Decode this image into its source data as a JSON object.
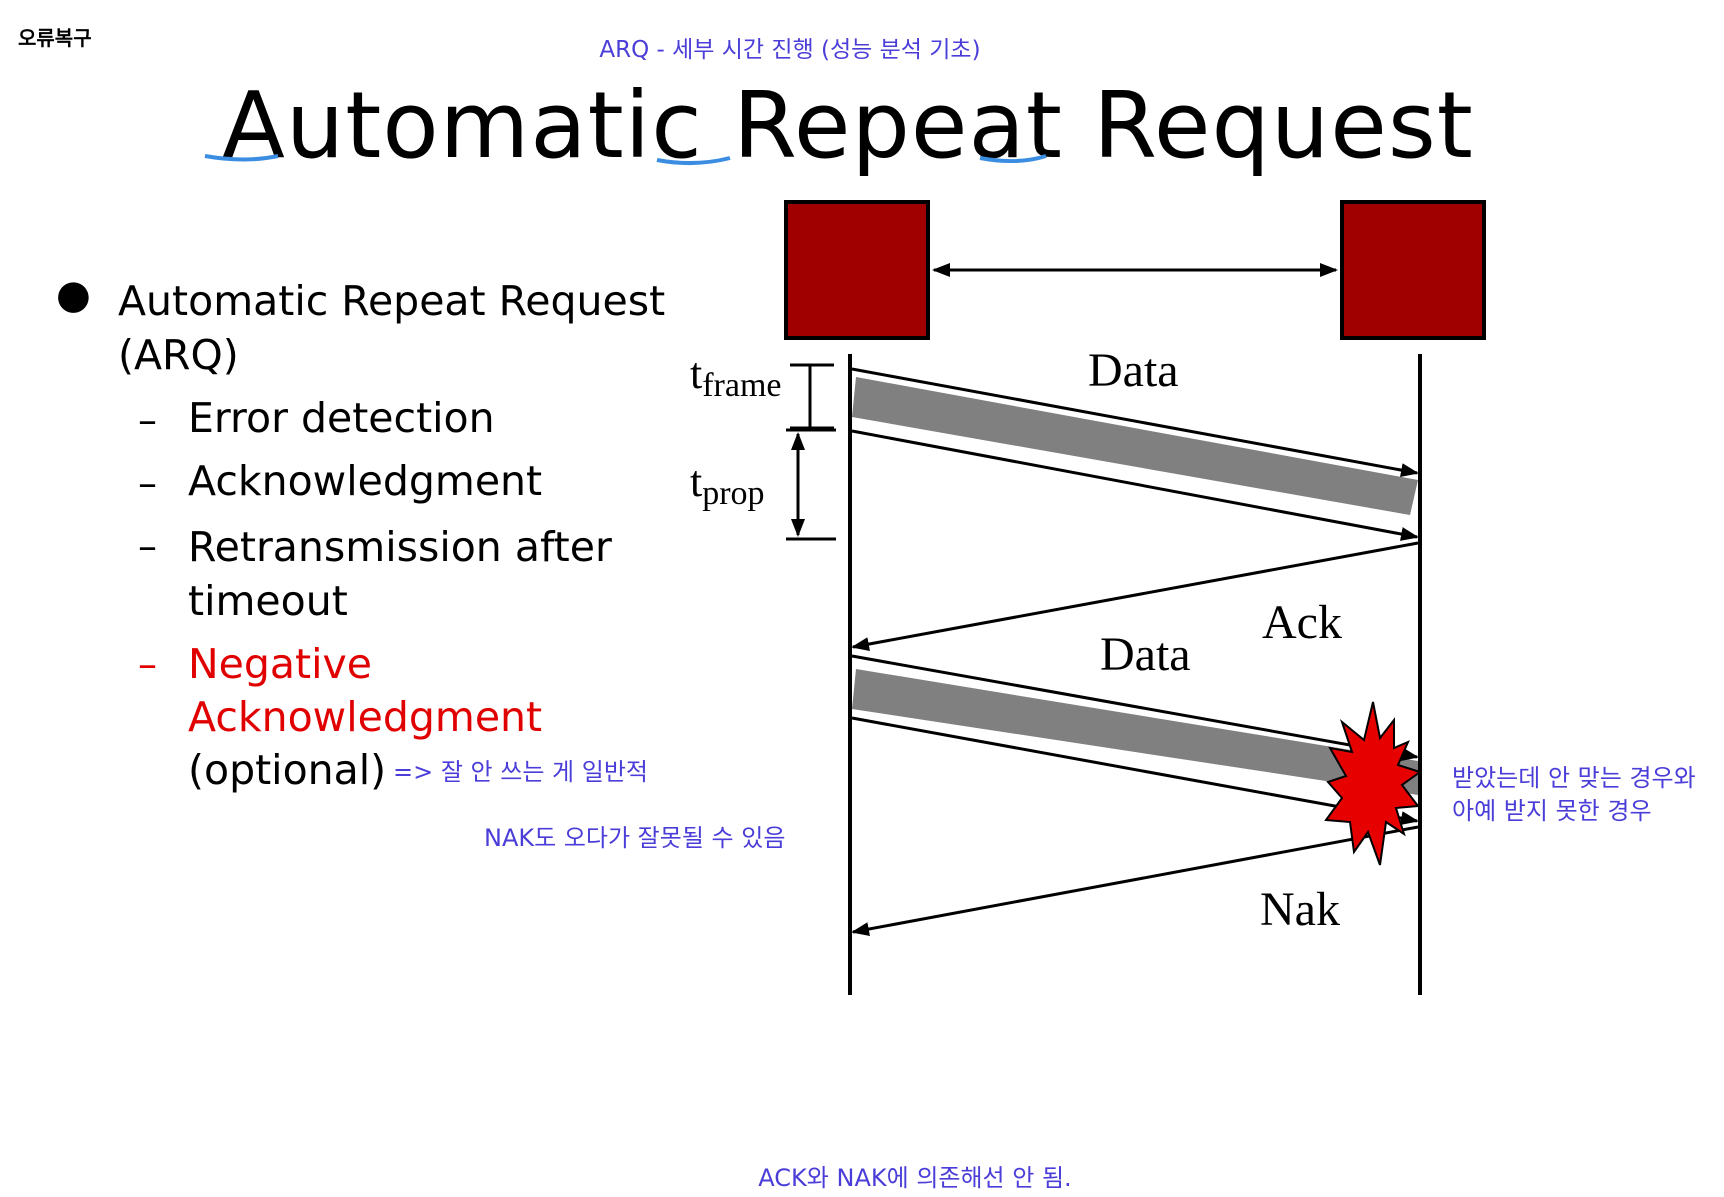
{
  "corner_label": "오류복구",
  "annotation_top": "ARQ - 세부 시간 진행 (성능 분석 기초)",
  "title": "Automatic Repeat Request",
  "bullets": {
    "main_line1": "Automatic Repeat Request",
    "main_line2": "(ARQ)",
    "items": [
      {
        "dash": "–",
        "lines": [
          "Error detection"
        ]
      },
      {
        "dash": "–",
        "lines": [
          "Acknowledgment"
        ]
      },
      {
        "dash": "–",
        "lines": [
          "Retransmission after",
          "timeout"
        ]
      },
      {
        "dash": "–",
        "lines": [
          "Negative",
          "Acknowledgment",
          "(optional)"
        ]
      }
    ]
  },
  "annotations": {
    "optional_note": "=> 잘 안 쓰는 게 일반적",
    "nak_note": "NAK도 오다가 잘못될 수 있음",
    "received_note": "받았는데 안 맞는 경우와\n아예 받지 못한 경우",
    "bottom_note": "ACK와 NAK에 의존해선 안 됨."
  },
  "diagram": {
    "t_frame_base": "t",
    "t_frame_sub": "frame",
    "t_prop_base": "t",
    "t_prop_sub": "prop",
    "data_label_1": "Data",
    "ack_label": "Ack",
    "data_label_2": "Data",
    "nak_label": "Nak"
  },
  "colors": {
    "node_fill": "#a00000",
    "frame_gray": "#808080",
    "annotation_blue": "#4b3ed8",
    "highlight_red": "#e00000",
    "burst_red": "#e60000",
    "underline_blue": "#3a8de0"
  }
}
